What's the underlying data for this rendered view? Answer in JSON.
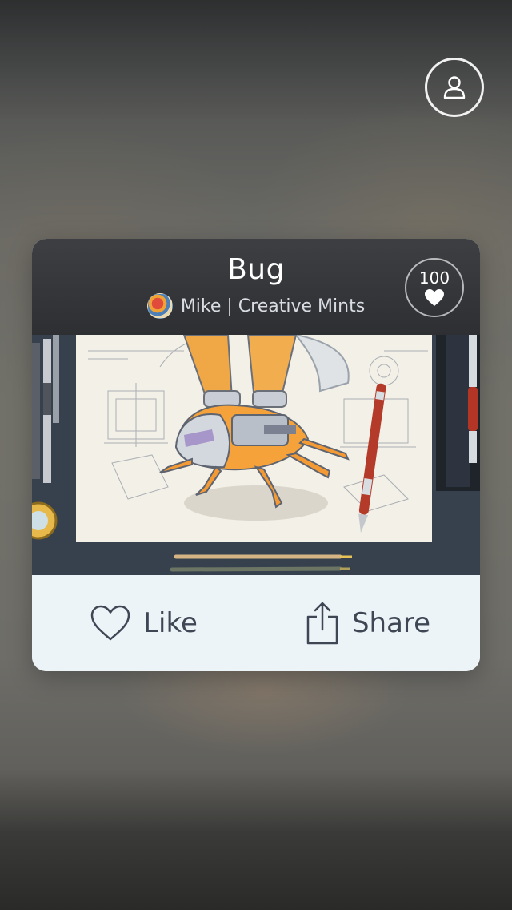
{
  "post": {
    "title": "Bug",
    "author": "Mike | Creative Mints",
    "likes": "100"
  },
  "actions": {
    "like_label": "Like",
    "share_label": "Share"
  },
  "icons": {
    "profile": "user-icon",
    "likes_badge": "heart-icon",
    "like": "heart-outline-icon",
    "share": "share-icon"
  },
  "colors": {
    "header_bg": "#2f3135",
    "actions_bg": "#edf4f8",
    "action_text": "#3f4654"
  }
}
